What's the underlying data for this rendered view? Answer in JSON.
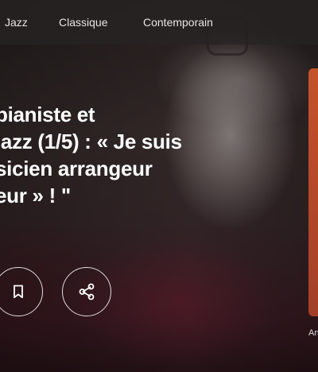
{
  "nav": {
    "items": [
      {
        "label": "Jazz"
      },
      {
        "label": "Classique"
      },
      {
        "label": "Contemporain"
      }
    ]
  },
  "article": {
    "title_lines": [
      "pianiste et",
      "jazz (1/5) : « Je suis",
      "sicien arrangeur",
      "eur » ! \""
    ]
  },
  "actions": {
    "bookmark_icon": "bookmark-icon",
    "share_icon": "share-icon"
  },
  "side_card": {
    "label": "An",
    "color": "#b94c2a"
  }
}
